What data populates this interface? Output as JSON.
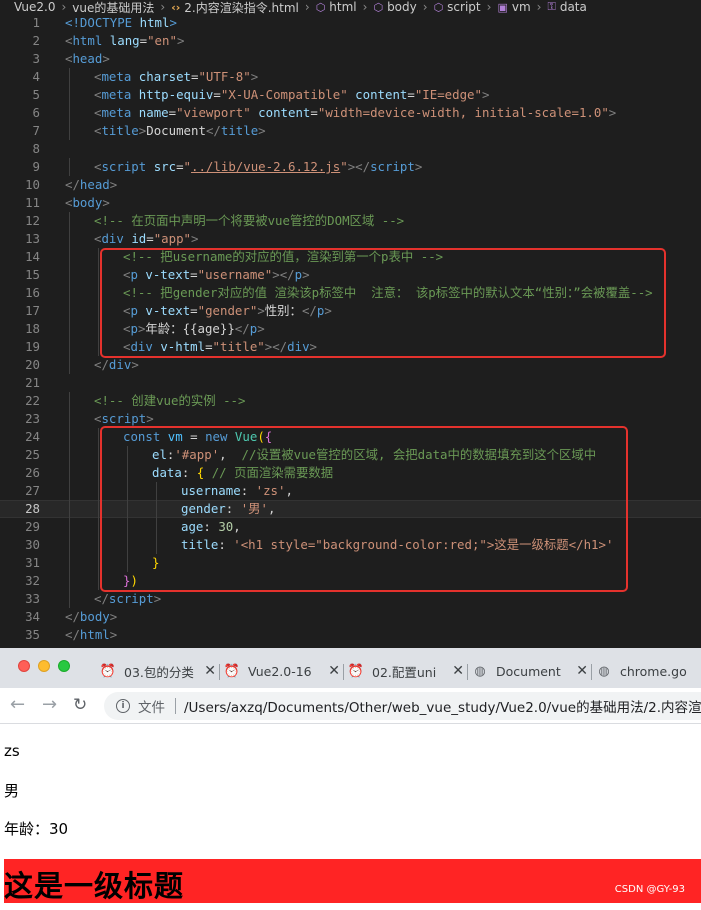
{
  "breadcrumb": [
    "Vue2.0",
    "vue的基础用法",
    "2.内容渲染指令.html",
    "html",
    "body",
    "script",
    "vm",
    "data"
  ],
  "editor": {
    "current_line": 28,
    "lines": [
      {
        "n": 1,
        "indent": 0,
        "tokens": [
          [
            "t-tag",
            "<!DOCTYPE "
          ],
          [
            "t-attr",
            "html"
          ],
          [
            "t-tag",
            ">"
          ]
        ]
      },
      {
        "n": 2,
        "indent": 0,
        "tokens": [
          [
            "t-gray",
            "<"
          ],
          [
            "t-tag",
            "html "
          ],
          [
            "t-attr",
            "lang"
          ],
          [
            "t-txt",
            "="
          ],
          [
            "t-str",
            "\"en\""
          ],
          [
            "t-gray",
            ">"
          ]
        ]
      },
      {
        "n": 3,
        "indent": 0,
        "tokens": [
          [
            "t-gray",
            "<"
          ],
          [
            "t-tag",
            "head"
          ],
          [
            "t-gray",
            ">"
          ]
        ]
      },
      {
        "n": 4,
        "indent": 1,
        "tokens": [
          [
            "t-gray",
            "<"
          ],
          [
            "t-tag",
            "meta "
          ],
          [
            "t-attr",
            "charset"
          ],
          [
            "t-txt",
            "="
          ],
          [
            "t-str",
            "\"UTF-8\""
          ],
          [
            "t-gray",
            ">"
          ]
        ]
      },
      {
        "n": 5,
        "indent": 1,
        "tokens": [
          [
            "t-gray",
            "<"
          ],
          [
            "t-tag",
            "meta "
          ],
          [
            "t-attr",
            "http-equiv"
          ],
          [
            "t-txt",
            "="
          ],
          [
            "t-str",
            "\"X-UA-Compatible\""
          ],
          [
            "t-txt",
            " "
          ],
          [
            "t-attr",
            "content"
          ],
          [
            "t-txt",
            "="
          ],
          [
            "t-str",
            "\"IE=edge\""
          ],
          [
            "t-gray",
            ">"
          ]
        ]
      },
      {
        "n": 6,
        "indent": 1,
        "tokens": [
          [
            "t-gray",
            "<"
          ],
          [
            "t-tag",
            "meta "
          ],
          [
            "t-attr",
            "name"
          ],
          [
            "t-txt",
            "="
          ],
          [
            "t-str",
            "\"viewport\""
          ],
          [
            "t-txt",
            " "
          ],
          [
            "t-attr",
            "content"
          ],
          [
            "t-txt",
            "="
          ],
          [
            "t-str",
            "\"width=device-width, initial-scale=1.0\""
          ],
          [
            "t-gray",
            ">"
          ]
        ]
      },
      {
        "n": 7,
        "indent": 1,
        "tokens": [
          [
            "t-gray",
            "<"
          ],
          [
            "t-tag",
            "title"
          ],
          [
            "t-gray",
            ">"
          ],
          [
            "t-txt",
            "Document"
          ],
          [
            "t-gray",
            "</"
          ],
          [
            "t-tag",
            "title"
          ],
          [
            "t-gray",
            ">"
          ]
        ]
      },
      {
        "n": 8,
        "indent": 0,
        "tokens": []
      },
      {
        "n": 9,
        "indent": 1,
        "tokens": [
          [
            "t-gray",
            "<"
          ],
          [
            "t-tag",
            "script "
          ],
          [
            "t-attr",
            "src"
          ],
          [
            "t-txt",
            "="
          ],
          [
            "t-str",
            "\""
          ],
          [
            "t-link",
            "../lib/vue-2.6.12.js"
          ],
          [
            "t-str",
            "\""
          ],
          [
            "t-gray",
            "></"
          ],
          [
            "t-tag",
            "script"
          ],
          [
            "t-gray",
            ">"
          ]
        ]
      },
      {
        "n": 10,
        "indent": 0,
        "tokens": [
          [
            "t-gray",
            "</"
          ],
          [
            "t-tag",
            "head"
          ],
          [
            "t-gray",
            ">"
          ]
        ]
      },
      {
        "n": 11,
        "indent": 0,
        "tokens": [
          [
            "t-gray",
            "<"
          ],
          [
            "t-tag",
            "body"
          ],
          [
            "t-gray",
            ">"
          ]
        ]
      },
      {
        "n": 12,
        "indent": 1,
        "tokens": [
          [
            "t-cmt",
            "<!-- 在页面中声明一个将要被vue管控的DOM区域 -->"
          ]
        ]
      },
      {
        "n": 13,
        "indent": 1,
        "tokens": [
          [
            "t-gray",
            "<"
          ],
          [
            "t-tag",
            "div "
          ],
          [
            "t-attr",
            "id"
          ],
          [
            "t-txt",
            "="
          ],
          [
            "t-str",
            "\"app\""
          ],
          [
            "t-gray",
            ">"
          ]
        ]
      },
      {
        "n": 14,
        "indent": 2,
        "tokens": [
          [
            "t-cmt",
            "<!-- 把username的对应的值，渲染到第一个p表中 -->"
          ]
        ]
      },
      {
        "n": 15,
        "indent": 2,
        "tokens": [
          [
            "t-gray",
            "<"
          ],
          [
            "t-tag",
            "p "
          ],
          [
            "t-attr",
            "v-text"
          ],
          [
            "t-txt",
            "="
          ],
          [
            "t-str",
            "\"username\""
          ],
          [
            "t-gray",
            "></"
          ],
          [
            "t-tag",
            "p"
          ],
          [
            "t-gray",
            ">"
          ]
        ]
      },
      {
        "n": 16,
        "indent": 2,
        "tokens": [
          [
            "t-cmt",
            "<!-- 把gender对应的值 渲染该p标签中  注意： 该p标签中的默认文本“性别：”会被覆盖-->"
          ]
        ]
      },
      {
        "n": 17,
        "indent": 2,
        "tokens": [
          [
            "t-gray",
            "<"
          ],
          [
            "t-tag",
            "p "
          ],
          [
            "t-attr",
            "v-text"
          ],
          [
            "t-txt",
            "="
          ],
          [
            "t-str",
            "\"gender\""
          ],
          [
            "t-gray",
            ">"
          ],
          [
            "t-txt",
            "性别："
          ],
          [
            "t-gray",
            "</"
          ],
          [
            "t-tag",
            "p"
          ],
          [
            "t-gray",
            ">"
          ]
        ]
      },
      {
        "n": 18,
        "indent": 2,
        "tokens": [
          [
            "t-gray",
            "<"
          ],
          [
            "t-tag",
            "p"
          ],
          [
            "t-gray",
            ">"
          ],
          [
            "t-txt",
            "年龄：{{age}}"
          ],
          [
            "t-gray",
            "</"
          ],
          [
            "t-tag",
            "p"
          ],
          [
            "t-gray",
            ">"
          ]
        ]
      },
      {
        "n": 19,
        "indent": 2,
        "tokens": [
          [
            "t-gray",
            "<"
          ],
          [
            "t-tag",
            "div "
          ],
          [
            "t-attr",
            "v-html"
          ],
          [
            "t-txt",
            "="
          ],
          [
            "t-str",
            "\"title\""
          ],
          [
            "t-gray",
            "></"
          ],
          [
            "t-tag",
            "div"
          ],
          [
            "t-gray",
            ">"
          ]
        ]
      },
      {
        "n": 20,
        "indent": 1,
        "tokens": [
          [
            "t-gray",
            "</"
          ],
          [
            "t-tag",
            "div"
          ],
          [
            "t-gray",
            ">"
          ]
        ]
      },
      {
        "n": 21,
        "indent": 0,
        "tokens": []
      },
      {
        "n": 22,
        "indent": 1,
        "tokens": [
          [
            "t-cmt",
            "<!-- 创建vue的实例 -->"
          ]
        ]
      },
      {
        "n": 23,
        "indent": 1,
        "tokens": [
          [
            "t-gray",
            "<"
          ],
          [
            "t-tag",
            "script"
          ],
          [
            "t-gray",
            ">"
          ]
        ]
      },
      {
        "n": 24,
        "indent": 2,
        "tokens": [
          [
            "t-kw",
            "const "
          ],
          [
            "t-var",
            "vm"
          ],
          [
            "t-txt",
            " = "
          ],
          [
            "t-kw",
            "new "
          ],
          [
            "t-cls",
            "Vue"
          ],
          [
            "t-br",
            "("
          ],
          [
            "t-br2",
            "{"
          ]
        ]
      },
      {
        "n": 25,
        "indent": 3,
        "tokens": [
          [
            "t-prop",
            "el"
          ],
          [
            "t-txt",
            ":"
          ],
          [
            "t-str",
            "'#app'"
          ],
          [
            "t-txt",
            ",  "
          ],
          [
            "t-cmt",
            "//设置被vue管控的区域, 会把data中的数据填充到这个区域中"
          ]
        ]
      },
      {
        "n": 26,
        "indent": 3,
        "tokens": [
          [
            "t-prop",
            "data"
          ],
          [
            "t-txt",
            ": "
          ],
          [
            "t-br",
            "{ "
          ],
          [
            "t-cmt",
            "// 页面渲染需要数据"
          ]
        ]
      },
      {
        "n": 27,
        "indent": 4,
        "tokens": [
          [
            "t-prop",
            "username"
          ],
          [
            "t-txt",
            ": "
          ],
          [
            "t-str",
            "'zs'"
          ],
          [
            "t-txt",
            ","
          ]
        ]
      },
      {
        "n": 28,
        "indent": 4,
        "tokens": [
          [
            "t-prop",
            "gender"
          ],
          [
            "t-txt",
            ": "
          ],
          [
            "t-str",
            "'男'"
          ],
          [
            "t-txt",
            ","
          ]
        ]
      },
      {
        "n": 29,
        "indent": 4,
        "tokens": [
          [
            "t-prop",
            "age"
          ],
          [
            "t-txt",
            ": "
          ],
          [
            "t-num",
            "30"
          ],
          [
            "t-txt",
            ","
          ]
        ]
      },
      {
        "n": 30,
        "indent": 4,
        "tokens": [
          [
            "t-prop",
            "title"
          ],
          [
            "t-txt",
            ": "
          ],
          [
            "t-str",
            "'<h1 style=\"background-color:red;\">这是一级标题</h1>'"
          ]
        ]
      },
      {
        "n": 31,
        "indent": 3,
        "tokens": [
          [
            "t-br",
            "}"
          ]
        ]
      },
      {
        "n": 32,
        "indent": 2,
        "tokens": [
          [
            "t-br2",
            "}"
          ],
          [
            "t-br",
            ")"
          ]
        ]
      },
      {
        "n": 33,
        "indent": 1,
        "tokens": [
          [
            "t-gray",
            "</"
          ],
          [
            "t-tag",
            "script"
          ],
          [
            "t-gray",
            ">"
          ]
        ]
      },
      {
        "n": 34,
        "indent": 0,
        "tokens": [
          [
            "t-gray",
            "</"
          ],
          [
            "t-tag",
            "body"
          ],
          [
            "t-gray",
            ">"
          ]
        ]
      },
      {
        "n": 35,
        "indent": 0,
        "tokens": [
          [
            "t-gray",
            "</"
          ],
          [
            "t-tag",
            "html"
          ],
          [
            "t-gray",
            ">"
          ]
        ]
      }
    ]
  },
  "browser": {
    "tabs": [
      {
        "label": "03.包的分类",
        "icon": "vue-icon"
      },
      {
        "label": "Vue2.0-16",
        "icon": "vue-icon"
      },
      {
        "label": "02.配置uni",
        "icon": "vue-icon"
      },
      {
        "label": "Document",
        "icon": "globe-icon"
      },
      {
        "label": "chrome.go",
        "icon": "globe-icon"
      }
    ],
    "address": {
      "scheme": "文件",
      "path": "/Users/axzq/Documents/Other/web_vue_study/Vue2.0/vue的基础用法/2.内容渲染指令.html"
    },
    "page": {
      "username": "zs",
      "gender": "男",
      "age_line": "年龄：30",
      "title_h1": "这是一级标题"
    },
    "credit": "CSDN @GY-93"
  },
  "colors": {
    "editor_bg": "#1e1e1e",
    "highlight_box": "#e5322d",
    "h1_bg": "#ff2424"
  }
}
